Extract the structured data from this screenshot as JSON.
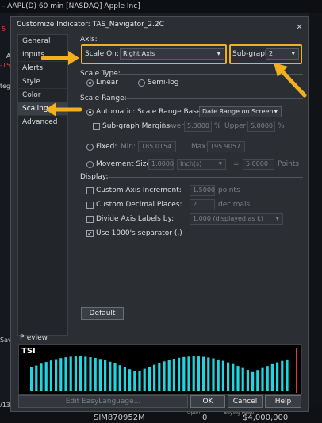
{
  "background": {
    "window_title": "- AAPL(D) 60 min [NASDAQ] Apple Inc]",
    "left_fragments": [
      "5",
      "A",
      "-15",
      "teg",
      "Sav",
      "/13"
    ],
    "bottom_account": "SIM870952M",
    "bottom_open": "Open",
    "bottom_open_value": "0",
    "bottom_buying": "Buying Power",
    "bottom_amount": "$4,000,000"
  },
  "dialog": {
    "title": "Customize Indicator: TAS_Navigator_2.2C",
    "close_glyph": "×"
  },
  "nav": {
    "items": [
      "General",
      "Inputs",
      "Alerts",
      "Style",
      "Color",
      "Scaling",
      "Advanced"
    ],
    "selected_index": 5
  },
  "axis": {
    "section": "Axis:",
    "scale_on_label": "Scale On:",
    "scale_on_value": "Right Axis",
    "subgraph_label": "Sub-graph:",
    "subgraph_value": "2"
  },
  "scale_type": {
    "section": "Scale Type:",
    "linear": "Linear",
    "semilog": "Semi-log",
    "selected": "linear"
  },
  "scale_range": {
    "section": "Scale Range:",
    "automatic": "Automatic: Scale Range Based on:",
    "based_on_value": "Date Range on Screen",
    "subgraph_margins": "Sub-graph Margins:",
    "lower_label": "Lower:",
    "lower_value": "5.0000",
    "upper_label": "Upper:",
    "upper_value": "5.0000",
    "pct": "%",
    "fixed": "Fixed:",
    "min_label": "Min:",
    "min_value": "185.0154",
    "max_label": "Max:",
    "max_value": "195.9057",
    "movement": "Movement Size:",
    "movement_value": "1.0000",
    "movement_unit": "Inch(s)",
    "equals": "=",
    "points_value": "5.0000",
    "points_label": "Points"
  },
  "display": {
    "section": "Display:",
    "custom_increment": "Custom Axis Increment:",
    "increment_value": "1.5000",
    "increment_unit": "points",
    "custom_decimals": "Custom Decimal Places:",
    "decimals_value": "2",
    "decimals_unit": "decimals",
    "divide_labels": "Divide Axis Labels by:",
    "divide_value": "1,000 (displayed as k)",
    "use_separator": "Use 1000's separator (,)",
    "check_glyph": "✓"
  },
  "buttons": {
    "default": "Default",
    "edit_easylanguage": "Edit EasyLanguage...",
    "ok": "OK",
    "cancel": "Cancel",
    "help": "Help"
  },
  "preview": {
    "label": "Preview",
    "indicator_name": "TSI",
    "bar_color": "#20d4e0",
    "signal_color": "#e23a3a"
  },
  "annotation_color": "#f2b01e"
}
